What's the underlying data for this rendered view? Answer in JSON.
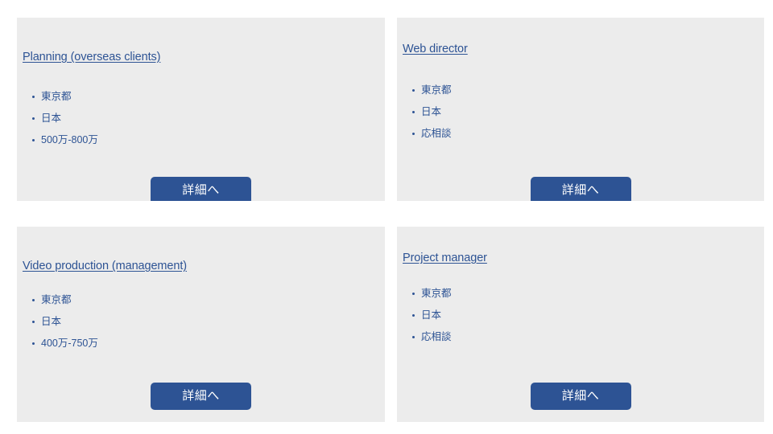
{
  "page": {
    "background_color": "#ffffff",
    "card_background_color": "#ececec",
    "accent_color": "#2d5394",
    "layout": "2x2-grid"
  },
  "cards": [
    {
      "id": "planning-overseas-clients",
      "title": "Planning (overseas clients)",
      "meta": [
        "東京都",
        "日本",
        "500万-800万"
      ],
      "button_label": "詳細へ"
    },
    {
      "id": "web-director",
      "title": "Web director",
      "meta": [
        "東京都",
        "日本",
        "応相談"
      ],
      "button_label": "詳細へ"
    },
    {
      "id": "video-production-management",
      "title": "Video production (management)",
      "meta": [
        "東京都",
        "日本",
        "400万-750万"
      ],
      "button_label": "詳細へ"
    },
    {
      "id": "project-manager",
      "title": "Project manager",
      "meta": [
        "東京都",
        "日本",
        "応相談"
      ],
      "button_label": "詳細へ"
    }
  ]
}
